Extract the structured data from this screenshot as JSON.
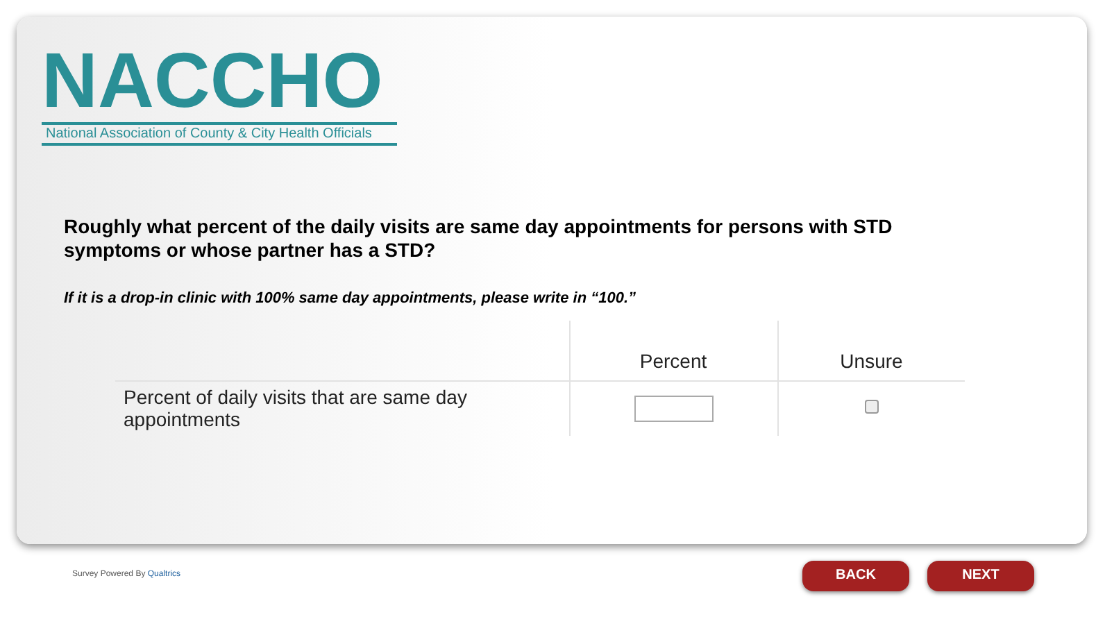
{
  "logo": {
    "name": "NACCHO",
    "subtitle": "National Association of County & City Health Officials"
  },
  "question": "Roughly what percent of the daily visits are same day appointments for persons with STD symptoms or whose partner has a STD?",
  "instruction": "If it is a drop-in clinic with 100% same day appointments, please write in “100.”",
  "table": {
    "columns": [
      "Percent",
      "Unsure"
    ],
    "rows": [
      {
        "label": "Percent of daily visits that are same day appointments",
        "unsure_checked": false
      }
    ]
  },
  "footer": {
    "powered_by": "Survey Powered By",
    "brand": "Qualtrics"
  },
  "buttons": [
    "BACK",
    "NEXT"
  ]
}
